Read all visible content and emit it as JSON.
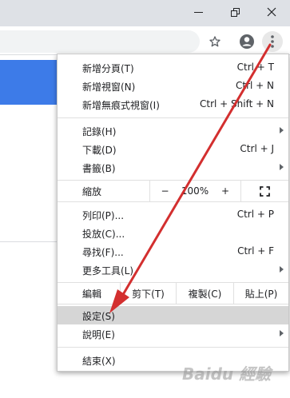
{
  "window": {
    "controls": [
      "minimize",
      "maximize",
      "close"
    ]
  },
  "toolbar": {
    "icons": [
      "star-icon",
      "profile-icon",
      "more-vert-icon"
    ]
  },
  "menu": {
    "new_tab": {
      "label": "新增分頁(T)",
      "shortcut": "Ctrl + T"
    },
    "new_window": {
      "label": "新增視窗(N)",
      "shortcut": "Ctrl + N"
    },
    "new_incognito": {
      "label": "新增無痕式視窗(I)",
      "shortcut": "Ctrl + Shift + N"
    },
    "history": {
      "label": "記錄(H)"
    },
    "downloads": {
      "label": "下載(D)",
      "shortcut": "Ctrl + J"
    },
    "bookmarks": {
      "label": "書籤(B)"
    },
    "zoom": {
      "label": "縮放",
      "minus": "−",
      "value": "100%",
      "plus": "+"
    },
    "print": {
      "label": "列印(P)...",
      "shortcut": "Ctrl + P"
    },
    "cast": {
      "label": "投放(C)..."
    },
    "find": {
      "label": "尋找(F)...",
      "shortcut": "Ctrl + F"
    },
    "more_tools": {
      "label": "更多工具(L)"
    },
    "edit": {
      "label": "編輯",
      "cut": "剪下(T)",
      "copy": "複製(C)",
      "paste": "貼上(P)"
    },
    "settings": {
      "label": "設定(S)"
    },
    "help": {
      "label": "說明(E)"
    },
    "exit": {
      "label": "結束(X)"
    }
  },
  "colors": {
    "arrow": "#d32f2f",
    "highlight": "#d6d6d6",
    "page_accent": "#3d7be8"
  },
  "watermark": "Baidu 經驗"
}
